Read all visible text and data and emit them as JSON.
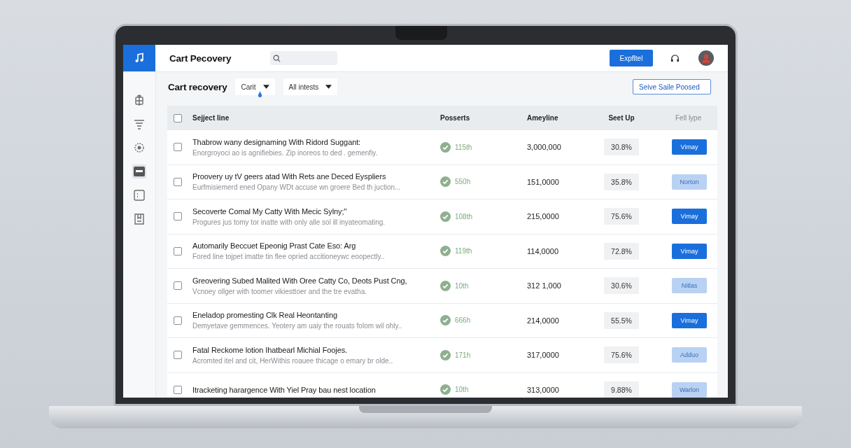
{
  "topbar": {
    "title": "Cart Pecovery",
    "button": "Expfltel"
  },
  "sidebar": {
    "items": [
      {
        "selected": false
      },
      {
        "selected": false
      },
      {
        "selected": false
      },
      {
        "selected": true
      },
      {
        "selected": false
      },
      {
        "selected": false
      }
    ]
  },
  "toolbar": {
    "title": "Cart recovery",
    "filters": [
      "Carit",
      "All intests"
    ],
    "sort": "Seive Saile Poosed"
  },
  "table": {
    "select_all_checked": false,
    "columns": [
      "Sejject line",
      "Posserts",
      "Ameyline",
      "Seet Up",
      "Fell lype"
    ],
    "rows": [
      {
        "checked": false,
        "subject": "Thabrow wany designaming With Ridord Suggant:",
        "preview": "Enorgroyoci ao is agnifiebies. Zip inoreos to ded . gemenfiy.",
        "status": "115th",
        "amount": "3,000,000",
        "rate": "30.8%",
        "action": "Vimay",
        "kind": "primary"
      },
      {
        "checked": false,
        "subject": "Proovery uy tV geers atad With Rets ane Deced Eyspliers",
        "preview": "Eurfmisiemerd ened Opany WDt accuse wn groere Bed th juction...",
        "status": "550h",
        "amount": "151,0000",
        "rate": "35.8%",
        "action": "Norton",
        "kind": "light"
      },
      {
        "checked": false,
        "subject": "Secoverte Comal My Catty With Mecic Sylny;\"",
        "preview": "Progures jus tomy tor inatte with only alle sol ill inyateomating.",
        "status": "108th",
        "amount": "215,0000",
        "rate": "75.6%",
        "action": "Vimay",
        "kind": "primary"
      },
      {
        "checked": false,
        "subject": "Automarily Beccuet Epeonig Prast Cate Eso: Arg",
        "preview": "Fored line tojpet imatte tin flee opried accitioneywc eoopectly..",
        "status": "119th",
        "amount": "114,0000",
        "rate": "72.8%",
        "action": "Vimay",
        "kind": "primary"
      },
      {
        "checked": false,
        "subject": "Greovering Subed Malited With Oree Catty Co, Deots Pust Cng,",
        "preview": "Vcnoey ollger with toomer vikiesttoer and the tre evatha.",
        "status": "10th",
        "amount": "312 1,000",
        "rate": "30.6%",
        "action": "Nitlas",
        "kind": "light"
      },
      {
        "checked": false,
        "subject": "Eneladop promesting Clk Real Heontanting",
        "preview": "Demyetave gemmences. Yeotery am uaiy the rouats folom wil ohly..",
        "status": "666h",
        "amount": "214,0000",
        "rate": "55.5%",
        "action": "Vimay",
        "kind": "primary"
      },
      {
        "checked": false,
        "subject": "Fatal Reckome lotion Ihatbearl Michial Foojes.",
        "preview": "Acromted itel and cit, HerWithis roauee thicage o emary br olde..",
        "status": "171h",
        "amount": "317,0000",
        "rate": "75.6%",
        "action": "Adduo",
        "kind": "light"
      },
      {
        "checked": false,
        "subject": "Itracketing harargence With Yiel Pray bau nest location",
        "status": "10th",
        "amount": "313,0000",
        "rate": "9.88%",
        "action": "Warlon",
        "kind": "light"
      }
    ]
  }
}
